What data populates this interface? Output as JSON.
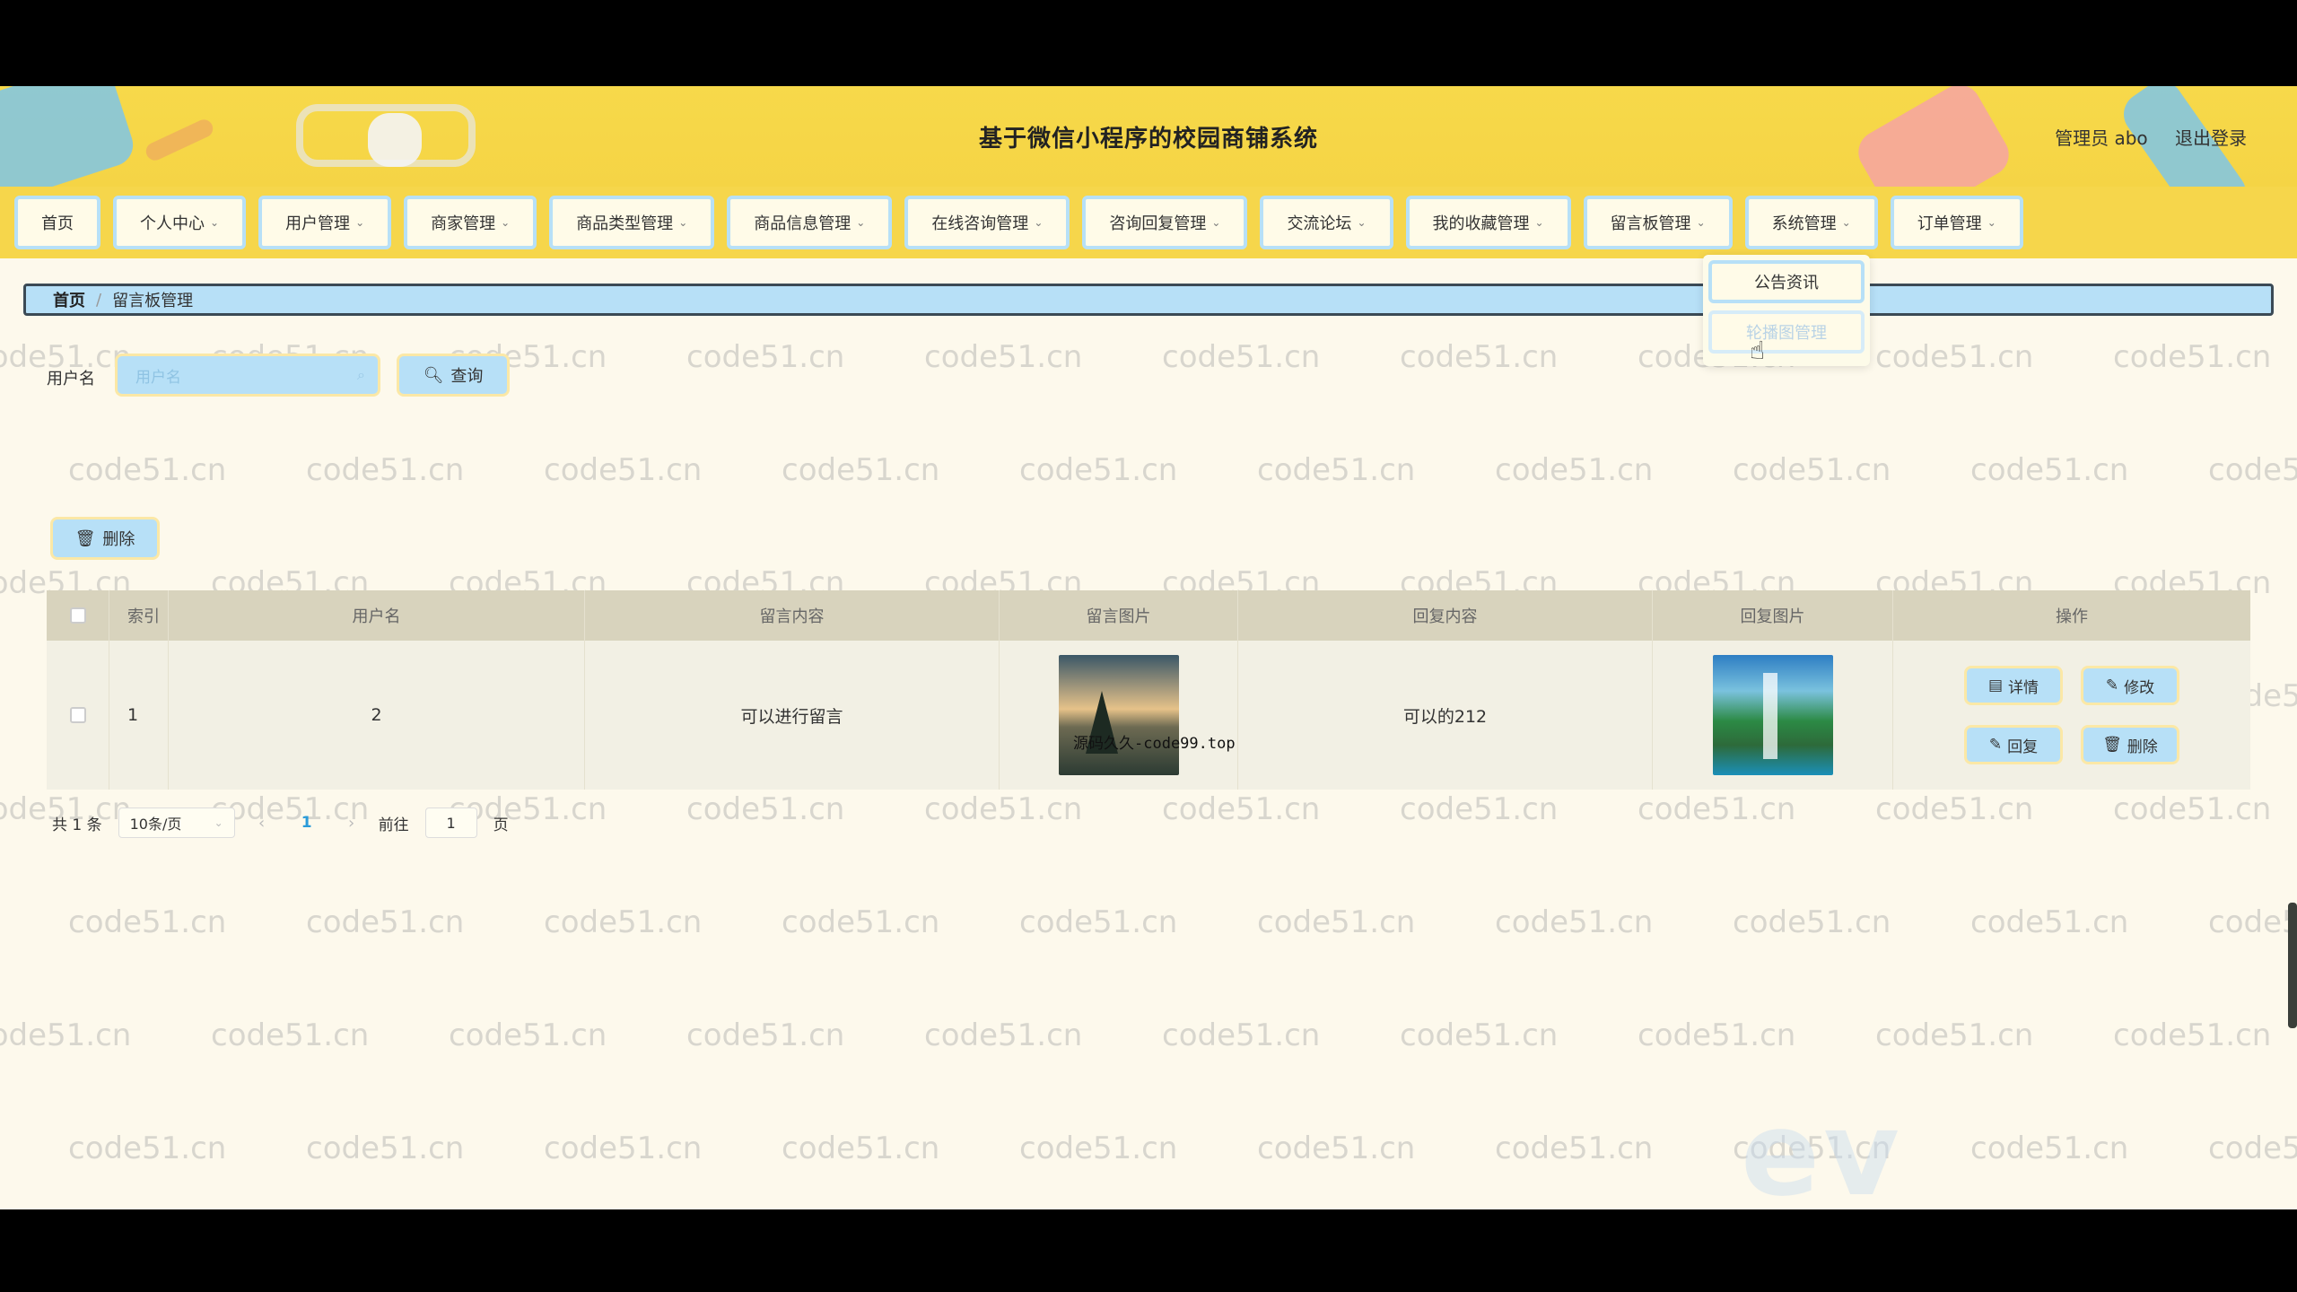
{
  "header": {
    "title": "基于微信小程序的校园商铺系统",
    "role_user": "管理员 abo",
    "logout": "退出登录"
  },
  "nav": {
    "items": [
      {
        "label": "首页",
        "chevron": false
      },
      {
        "label": "个人中心",
        "chevron": true
      },
      {
        "label": "用户管理",
        "chevron": true
      },
      {
        "label": "商家管理",
        "chevron": true
      },
      {
        "label": "商品类型管理",
        "chevron": true
      },
      {
        "label": "商品信息管理",
        "chevron": true
      },
      {
        "label": "在线咨询管理",
        "chevron": true
      },
      {
        "label": "咨询回复管理",
        "chevron": true
      },
      {
        "label": "交流论坛",
        "chevron": true
      },
      {
        "label": "我的收藏管理",
        "chevron": true
      },
      {
        "label": "留言板管理",
        "chevron": true
      },
      {
        "label": "系统管理",
        "chevron": true
      },
      {
        "label": "订单管理",
        "chevron": true
      }
    ],
    "dropdown": [
      "公告资讯",
      "轮播图管理"
    ]
  },
  "breadcrumb": {
    "home": "首页",
    "current": "留言板管理"
  },
  "search": {
    "label": "用户名",
    "placeholder": "用户名",
    "button": "查询"
  },
  "toolbar": {
    "delete": "删除"
  },
  "table": {
    "headers": [
      "索引",
      "用户名",
      "留言内容",
      "留言图片",
      "回复内容",
      "回复图片",
      "操作"
    ],
    "rows": [
      {
        "index": "1",
        "username": "2",
        "message": "可以进行留言",
        "reply": "可以的212"
      }
    ],
    "actions": {
      "detail": "详情",
      "edit": "修改",
      "reply": "回复",
      "delete": "删除"
    }
  },
  "image_overlay_text": "源码久久-code99.top",
  "pagination": {
    "total": "共 1 条",
    "page_size": "10条/页",
    "current": "1",
    "goto_label": "前往",
    "goto_value": "1",
    "page_suffix": "页"
  },
  "watermark": "code51.cn",
  "video_logo": "ev"
}
